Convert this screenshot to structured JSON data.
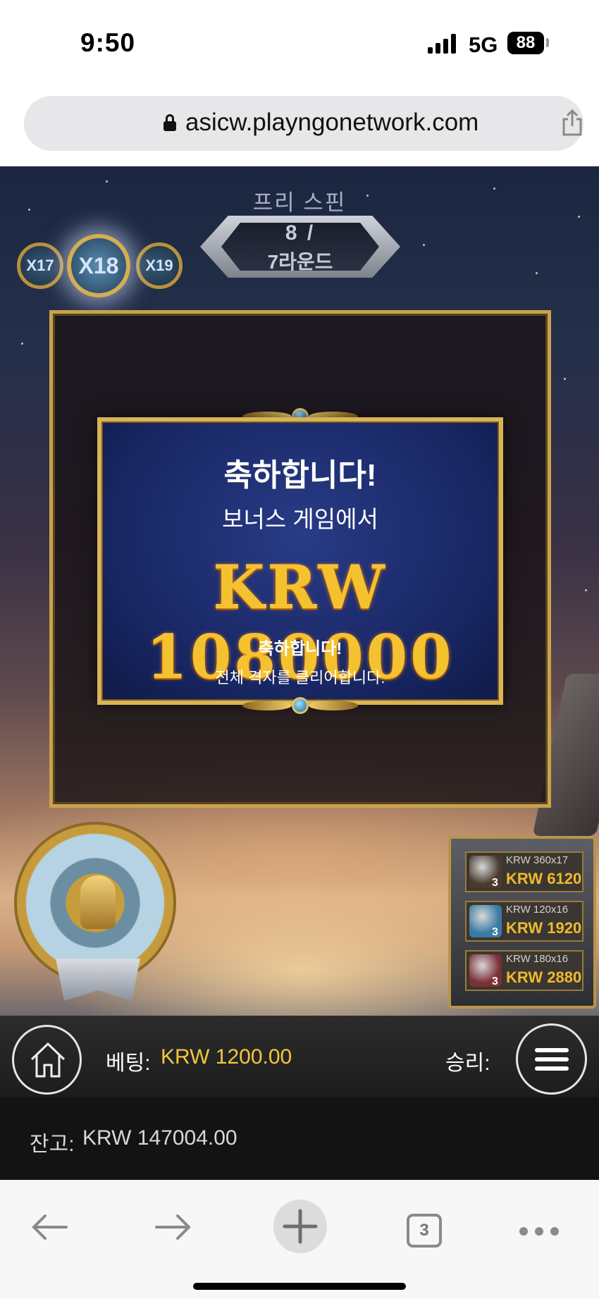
{
  "status_bar": {
    "time": "9:50",
    "network": "5G",
    "battery": "88"
  },
  "browser": {
    "url": "asicw.playngonetwork.com",
    "tabs_count": "3"
  },
  "game": {
    "free_spins_label": "프리 스핀",
    "free_spins_count": "8 /",
    "free_spins_rounds": "7라운드",
    "multipliers": {
      "left": "X17",
      "current": "X18",
      "right": "X19"
    },
    "win_panel": {
      "title": "축하합니다!",
      "subtitle": "보너스 게임에서",
      "amount": "KRW 1080000",
      "message": "축하합니다!",
      "detail": "전체 격자를 클리어합니다."
    },
    "paytable": [
      {
        "count": "3",
        "line1": "KRW 360x17",
        "line2": "KRW 6120",
        "color": "#4a3b2e"
      },
      {
        "count": "3",
        "line1": "KRW 120x16",
        "line2": "KRW 1920",
        "color": "#3a7aa3"
      },
      {
        "count": "3",
        "line1": "KRW 180x16",
        "line2": "KRW 2880",
        "color": "#7a3036"
      }
    ]
  },
  "controls": {
    "bet_label": "베팅:",
    "bet_value": "KRW 1200.00",
    "win_label": "승리:",
    "balance_label": "잔고:",
    "balance_value": "KRW 147004.00"
  },
  "colors": {
    "gold": "#f3c73b",
    "panel_blue": "#1b2a6b",
    "frame_gold": "#c9a24b"
  }
}
